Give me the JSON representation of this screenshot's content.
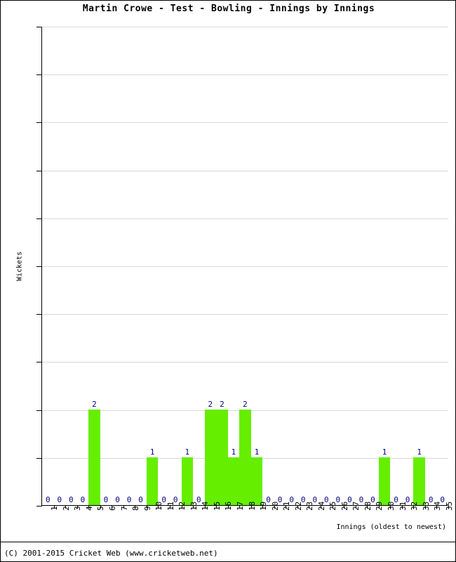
{
  "title": "Martin Crowe - Test - Bowling - Innings by Innings",
  "footer": "(C) 2001-2015 Cricket Web (www.cricketweb.net)",
  "axes": {
    "y_title": "Wickets",
    "x_title": "Innings (oldest to newest)"
  },
  "colors": {
    "bar": "#66ee00",
    "value_label": "#000080",
    "gridline": "#d8d8d8",
    "axis": "#000000",
    "background": "#ffffff"
  },
  "chart_data": {
    "type": "bar",
    "title": "Martin Crowe - Test - Bowling - Innings by Innings",
    "xlabel": "Innings (oldest to newest)",
    "ylabel": "Wickets",
    "ylim": [
      0,
      10
    ],
    "yticks": [
      0,
      1,
      2,
      3,
      4,
      5,
      6,
      7,
      8,
      9,
      10
    ],
    "grid": true,
    "legend": "none",
    "bar_gap": 0,
    "show_value_labels": true,
    "categories": [
      "1",
      "2",
      "3",
      "4",
      "5",
      "6",
      "7",
      "8",
      "9",
      "10",
      "11",
      "12",
      "13",
      "14",
      "15",
      "16",
      "17",
      "18",
      "19",
      "20",
      "21",
      "22",
      "23",
      "24",
      "25",
      "26",
      "27",
      "28",
      "29",
      "30",
      "31",
      "32",
      "33",
      "34",
      "35"
    ],
    "values": [
      0,
      0,
      0,
      0,
      2,
      0,
      0,
      0,
      0,
      1,
      0,
      0,
      1,
      0,
      2,
      2,
      1,
      2,
      1,
      0,
      0,
      0,
      0,
      0,
      0,
      0,
      0,
      0,
      0,
      1,
      0,
      0,
      1,
      0,
      0
    ]
  }
}
